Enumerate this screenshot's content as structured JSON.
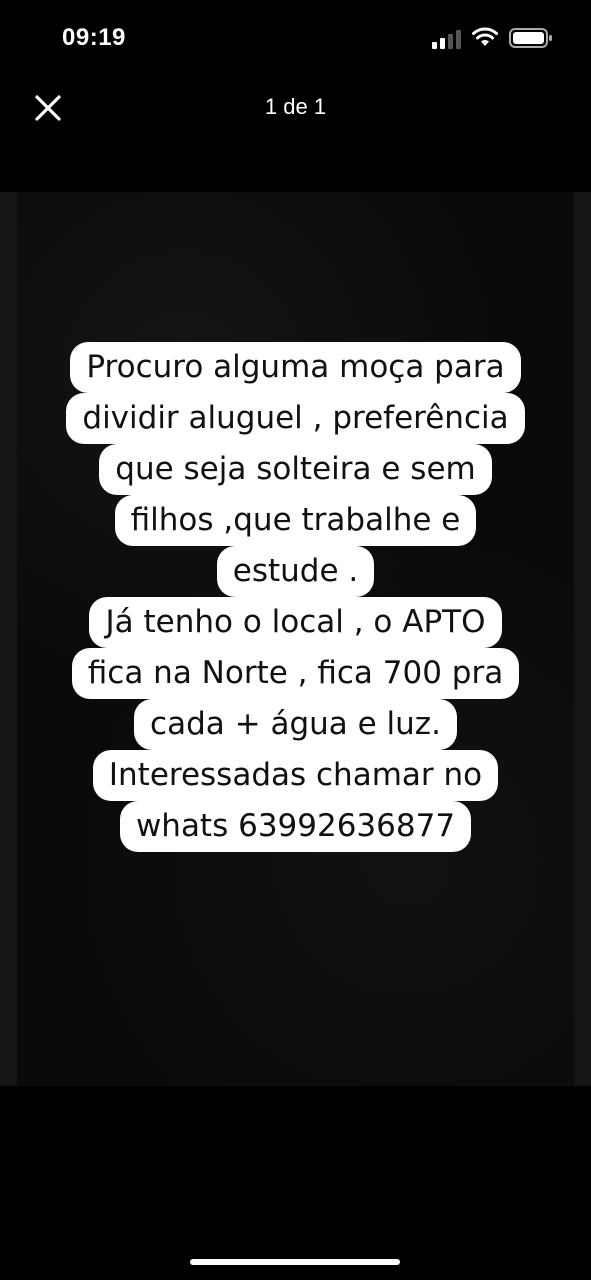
{
  "status_bar": {
    "time": "09:19"
  },
  "viewer": {
    "page_counter": "1 de 1",
    "close_icon": "close-icon"
  },
  "post": {
    "lines": [
      "Procuro alguma moça para",
      "dividir aluguel , preferência",
      "que seja solteira e sem",
      "filhos ,que trabalhe e",
      "estude .",
      "Já tenho o local , o APTO",
      "fica na Norte , fica 700 pra",
      "cada + água e luz.",
      "Interessadas chamar no",
      "whats 63992636877"
    ]
  },
  "colors": {
    "background": "#000000",
    "text_highlight": "#ffffff",
    "text": "#111111"
  }
}
